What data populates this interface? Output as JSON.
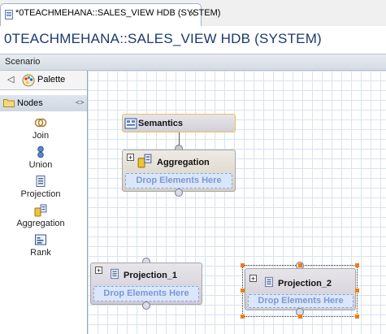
{
  "editor": {
    "tab_label": "*0TEACHMEHANA::SALES_VIEW HDB (SYSTEM)",
    "close_glyph": "⨯",
    "title": "0TEACHMEHANA::SALES_VIEW HDB (SYSTEM)"
  },
  "scenario": {
    "label": "Scenario"
  },
  "palette": {
    "back_glyph": "◁",
    "label": "Palette",
    "nodes_label": "Nodes",
    "collapse_glyph": "<>",
    "tools": [
      {
        "label": "Join",
        "icon": "join-icon"
      },
      {
        "label": "Union",
        "icon": "union-icon"
      },
      {
        "label": "Projection",
        "icon": "projection-icon"
      },
      {
        "label": "Aggregation",
        "icon": "aggregation-icon"
      },
      {
        "label": "Rank",
        "icon": "rank-icon"
      }
    ]
  },
  "canvas": {
    "semantics": {
      "label": "Semantics"
    },
    "aggregation": {
      "label": "Aggregation",
      "drop_text": "Drop Elements Here",
      "expand_glyph": "+"
    },
    "projection_1": {
      "label": "Projection_1",
      "drop_text": "Drop Elements Here",
      "expand_glyph": "+"
    },
    "projection_2": {
      "label": "Projection_2",
      "drop_text": "Drop Elements Here",
      "expand_glyph": "+",
      "selected": true
    }
  },
  "colors": {
    "accent": "#1b3a6b",
    "selection_handle": "#f07d10",
    "drop_zone": "#dbe6fa"
  }
}
